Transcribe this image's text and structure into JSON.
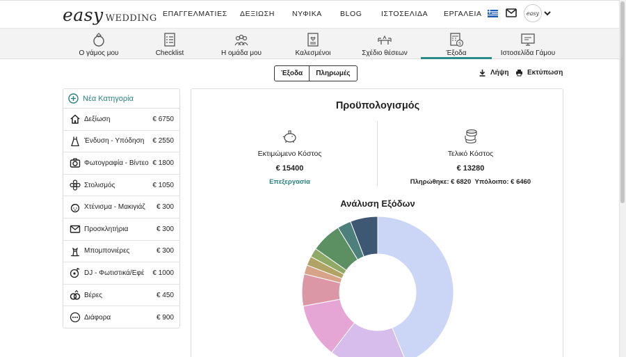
{
  "brand": {
    "logo_easy": "easy",
    "logo_wedding": "WEDDING"
  },
  "topnav": [
    "ΕΠΑΓΓΕΛΜΑΤΙΕΣ",
    "ΔΕΞΙΩΣΗ",
    "ΝΥΦΙΚΑ",
    "BLOG",
    "ΙΣΤΟΣΕΛΙΔΑ",
    "ΕΡΓΑΛΕΙΑ"
  ],
  "user": {
    "avatar_text": "easy"
  },
  "subnav": [
    {
      "label": "Ο γάμος μου",
      "icon": "ring-icon"
    },
    {
      "label": "Checklist",
      "icon": "checklist-icon"
    },
    {
      "label": "Η ομάδα μου",
      "icon": "team-icon"
    },
    {
      "label": "Καλεσμένοι",
      "icon": "guests-icon"
    },
    {
      "label": "Σχέδιο θέσεων",
      "icon": "seating-icon"
    },
    {
      "label": "Έξοδα",
      "icon": "expenses-icon",
      "active": true
    },
    {
      "label": "Ιστοσελίδα Γάμου",
      "icon": "website-icon"
    }
  ],
  "toggle": {
    "left": "Έξοδα",
    "right": "Πληρωμές"
  },
  "actions": {
    "download": "Λήψη",
    "print": "Εκτύπωση"
  },
  "categories": {
    "new_label": "Νέα Κατηγορία",
    "items": [
      {
        "name": "Δεξίωση",
        "amount": "€ 6750",
        "icon": "home-icon"
      },
      {
        "name": "Ένδυση - Υπόδηση",
        "amount": "€ 2550",
        "icon": "dress-icon"
      },
      {
        "name": "Φωτογραφία - Βίντεο",
        "amount": "€ 1800",
        "icon": "camera-icon"
      },
      {
        "name": "Στολισμός",
        "amount": "€ 1050",
        "icon": "flower-icon"
      },
      {
        "name": "Χτένισμα - Μακιγιάζ",
        "amount": "€ 300",
        "icon": "makeup-icon"
      },
      {
        "name": "Προσκλητήρια",
        "amount": "€ 300",
        "icon": "envelope-icon"
      },
      {
        "name": "Μπομπονιέρες",
        "amount": "€ 300",
        "icon": "favors-icon"
      },
      {
        "name": "DJ - Φωτιστικά/Εφέ",
        "amount": "€ 1000",
        "icon": "music-icon"
      },
      {
        "name": "Βέρες",
        "amount": "€ 450",
        "icon": "rings-icon"
      },
      {
        "name": "Διάφορα",
        "amount": "€ 900",
        "icon": "more-icon"
      }
    ]
  },
  "budget": {
    "title": "Προϋπολογισμός",
    "estimated": {
      "label": "Εκτιμώμενο Κόστος",
      "amount": "€ 15400",
      "edit": "Επεξεργασία"
    },
    "final": {
      "label": "Τελικό Κόστος",
      "amount": "€ 13280",
      "paid": "Πληρώθηκε: € 6820",
      "remaining": "Υπόλοιπο: € 6460"
    }
  },
  "chart_data": {
    "type": "pie",
    "title": "Ανάλυση Εξόδων",
    "categories": [
      "Δεξίωση",
      "Ένδυση - Υπόδηση",
      "Φωτογραφία - Βίντεο",
      "Στολισμός",
      "Χτένισμα - Μακιγιάζ",
      "Προσκλητήρια",
      "Μπομπονιέρες",
      "DJ - Φωτιστικά/Εφέ",
      "Βέρες",
      "Διάφορα"
    ],
    "values": [
      6750,
      2550,
      1800,
      1050,
      300,
      300,
      300,
      1000,
      450,
      900
    ],
    "colors": [
      "#cbd5f6",
      "#d6bdec",
      "#e5a6d5",
      "#db97a6",
      "#d7a389",
      "#b0a364",
      "#8faa66",
      "#5c9062",
      "#4d7f7c",
      "#3e5773"
    ]
  }
}
